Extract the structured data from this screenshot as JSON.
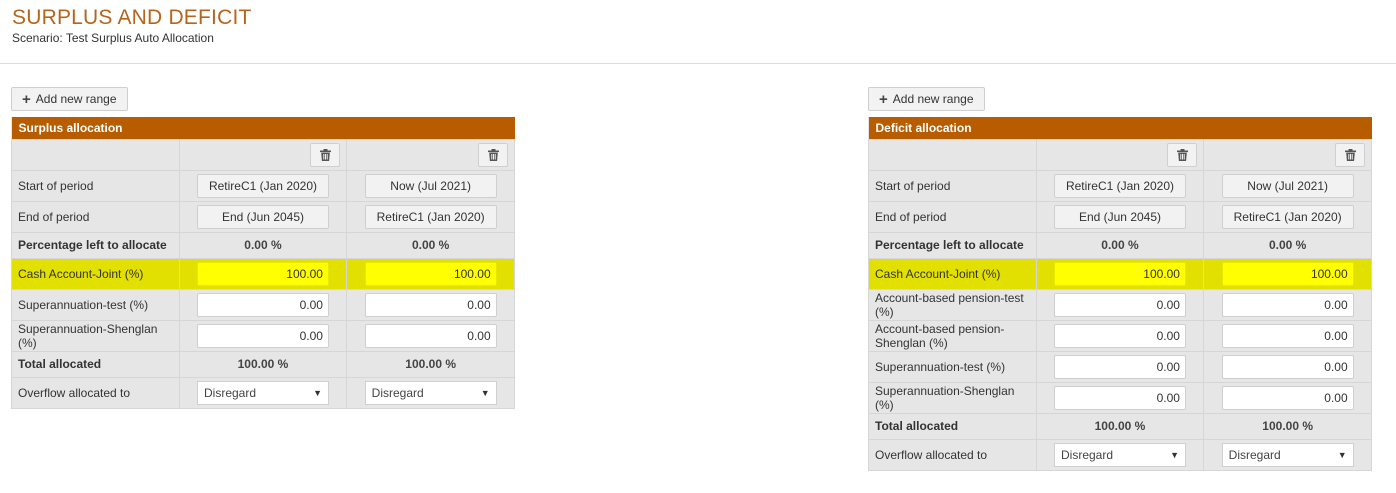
{
  "header": {
    "title": "SURPLUS AND DEFICIT",
    "subtitle": "Scenario: Test Surplus Auto Allocation"
  },
  "colors": {
    "accent": "#b85c00",
    "title": "#b5651d",
    "highlight": "#ffff00"
  },
  "icons": {
    "add": "plus-icon",
    "delete": "trash-icon",
    "dropdown": "caret-down-icon"
  },
  "surplus": {
    "add_label": "Add new range",
    "table_title": "Surplus allocation",
    "start_label": "Start of period",
    "start_values": [
      "RetireC1 (Jan 2020)",
      "Now (Jul 2021)"
    ],
    "end_label": "End of period",
    "end_values": [
      "End (Jun 2045)",
      "RetireC1 (Jan 2020)"
    ],
    "pct_label": "Percentage left to allocate",
    "pct_values": [
      "0.00 %",
      "0.00 %"
    ],
    "rows": [
      {
        "label": "Cash Account-Joint (%)",
        "values": [
          "100.00",
          "100.00"
        ]
      },
      {
        "label": "Superannuation-test (%)",
        "values": [
          "0.00",
          "0.00"
        ]
      },
      {
        "label": "Superannuation-Shenglan (%)",
        "values": [
          "0.00",
          "0.00"
        ]
      }
    ],
    "total_label": "Total allocated",
    "total_values": [
      "100.00 %",
      "100.00 %"
    ],
    "overflow_label": "Overflow allocated to",
    "overflow_values": [
      "Disregard",
      "Disregard"
    ]
  },
  "deficit": {
    "add_label": "Add new range",
    "table_title": "Deficit allocation",
    "start_label": "Start of period",
    "start_values": [
      "RetireC1 (Jan 2020)",
      "Now (Jul 2021)"
    ],
    "end_label": "End of period",
    "end_values": [
      "End (Jun 2045)",
      "RetireC1 (Jan 2020)"
    ],
    "pct_label": "Percentage left to allocate",
    "pct_values": [
      "0.00 %",
      "0.00 %"
    ],
    "rows": [
      {
        "label": "Cash Account-Joint (%)",
        "values": [
          "100.00",
          "100.00"
        ]
      },
      {
        "label": "Account-based pension-test (%)",
        "values": [
          "0.00",
          "0.00"
        ]
      },
      {
        "label": "Account-based pension-Shenglan (%)",
        "values": [
          "0.00",
          "0.00"
        ]
      },
      {
        "label": "Superannuation-test (%)",
        "values": [
          "0.00",
          "0.00"
        ]
      },
      {
        "label": "Superannuation-Shenglan (%)",
        "values": [
          "0.00",
          "0.00"
        ]
      }
    ],
    "total_label": "Total allocated",
    "total_values": [
      "100.00 %",
      "100.00 %"
    ],
    "overflow_label": "Overflow allocated to",
    "overflow_values": [
      "Disregard",
      "Disregard"
    ]
  }
}
